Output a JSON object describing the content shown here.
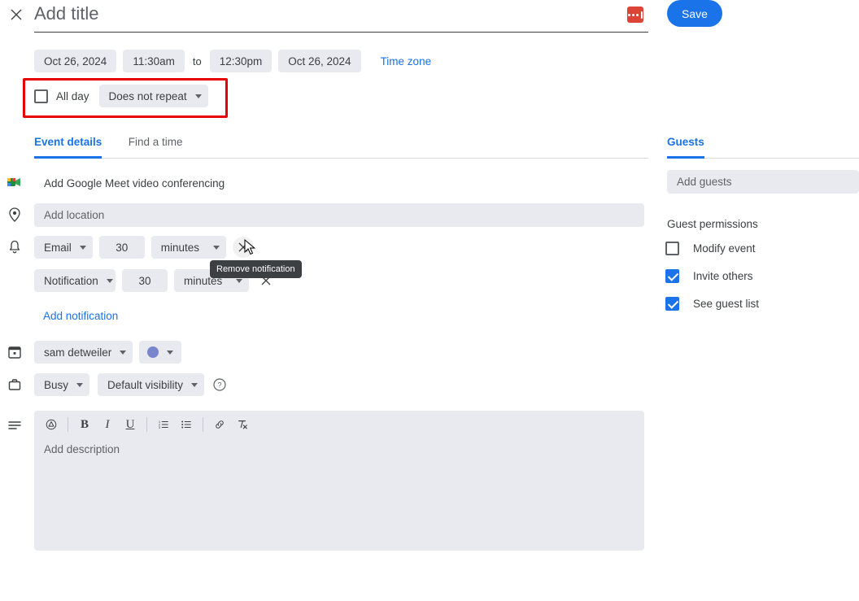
{
  "header": {
    "close_icon": "close-icon",
    "title_placeholder": "Add title",
    "more_options_icon": "more-options-icon",
    "save_label": "Save"
  },
  "schedule": {
    "start_date": "Oct 26, 2024",
    "start_time": "11:30am",
    "separator": "to",
    "end_time": "12:30pm",
    "end_date": "Oct 26, 2024",
    "timezone_label": "Time zone",
    "all_day_label": "All day",
    "all_day_checked": false,
    "repeat_label": "Does not repeat"
  },
  "tabs": {
    "left": [
      {
        "label": "Event details",
        "active": true
      },
      {
        "label": "Find a time",
        "active": false
      }
    ],
    "right": [
      {
        "label": "Guests",
        "active": true
      }
    ]
  },
  "details": {
    "meet_icon": "google-meet-icon",
    "meet_label": "Add Google Meet video conferencing",
    "location_icon": "location-pin-icon",
    "location_placeholder": "Add location",
    "notification_icon": "bell-icon",
    "notifications": [
      {
        "type": "Email",
        "amount": "30",
        "unit": "minutes"
      },
      {
        "type": "Notification",
        "amount": "30",
        "unit": "minutes"
      }
    ],
    "add_notification_label": "Add notification",
    "calendar_icon": "calendar-icon",
    "calendar_owner": "sam detweiler",
    "color_swatch": "#7986cb",
    "busy_icon": "briefcase-icon",
    "busy_label": "Busy",
    "visibility_label": "Default visibility",
    "help_icon": "help-circle-icon",
    "description_icon": "description-lines-icon",
    "description_placeholder": "Add description",
    "description_toolbar": [
      {
        "icon": "drive-insert-icon",
        "glyph": ""
      },
      {
        "icon": "bold-icon",
        "glyph": "B"
      },
      {
        "icon": "italic-icon",
        "glyph": "I"
      },
      {
        "icon": "underline-icon",
        "glyph": "U"
      },
      {
        "icon": "numbered-list-icon",
        "glyph": ""
      },
      {
        "icon": "bulleted-list-icon",
        "glyph": ""
      },
      {
        "icon": "link-icon",
        "glyph": ""
      },
      {
        "icon": "clear-formatting-icon",
        "glyph": ""
      }
    ]
  },
  "guests": {
    "add_guests_placeholder": "Add guests",
    "permissions_title": "Guest permissions",
    "permissions": [
      {
        "label": "Modify event",
        "checked": false
      },
      {
        "label": "Invite others",
        "checked": true
      },
      {
        "label": "See guest list",
        "checked": true
      }
    ]
  },
  "tooltip": {
    "text": "Remove notification"
  },
  "colors": {
    "accent": "#1a73e8",
    "field_bg": "#e8eaf0",
    "highlight": "#e80000",
    "more_btn_bg": "#db4437",
    "tooltip_bg": "#3c4043"
  }
}
